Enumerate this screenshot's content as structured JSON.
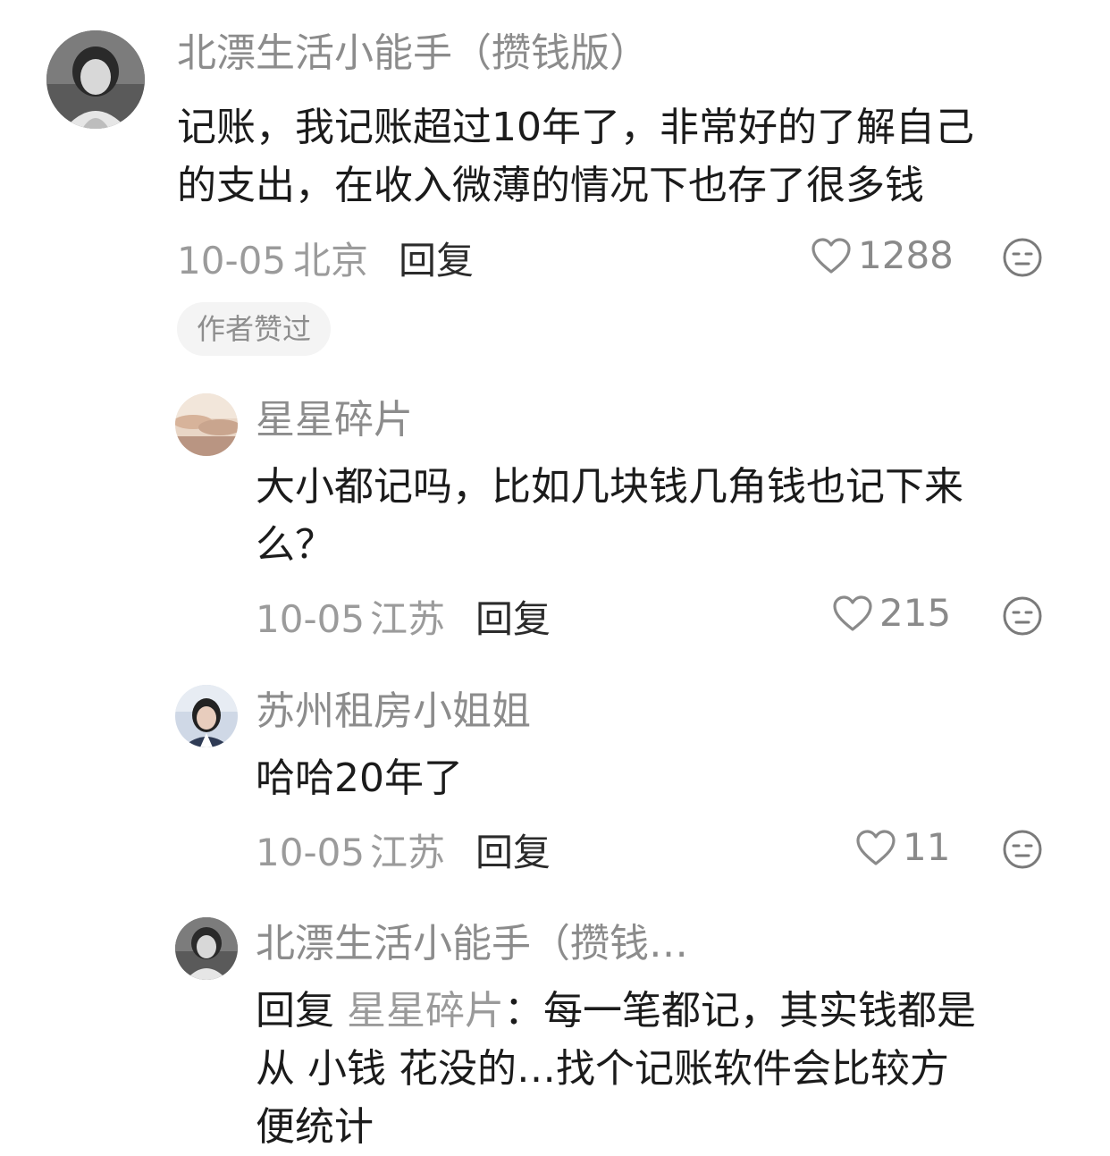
{
  "comments": [
    {
      "username": "北漂生活小能手（攒钱版）",
      "text_lines": [
        "记账，我记账超过10年了，非常好的了解自己",
        "的支出，在收入微薄的情况下也存了很多钱"
      ],
      "date": "10-05",
      "location": "北京",
      "reply_label": "回复",
      "likes": "1288",
      "badge": "作者赞过"
    },
    {
      "username": "星星碎片",
      "text_lines": [
        "大小都记吗，比如几块钱几角钱也记下来",
        "么？"
      ],
      "date": "10-05",
      "location": "江苏",
      "reply_label": "回复",
      "likes": "215"
    },
    {
      "username": "苏州租房小姐姐",
      "text_lines": [
        "哈哈20年了"
      ],
      "date": "10-05",
      "location": "江苏",
      "reply_label": "回复",
      "likes": "11"
    },
    {
      "username": "北漂生活小能手（攒钱…",
      "reply_prefix": "回复",
      "reply_to": "星星碎片",
      "reply_first_line_rest": "：每一笔都记，其实钱都是",
      "text_lines": [
        "从 小钱 花没的…找个记账软件会比较方",
        "便统计"
      ]
    }
  ],
  "icons": {
    "like": "heart-outline-icon",
    "more": "neutral-face-emoji-icon"
  }
}
